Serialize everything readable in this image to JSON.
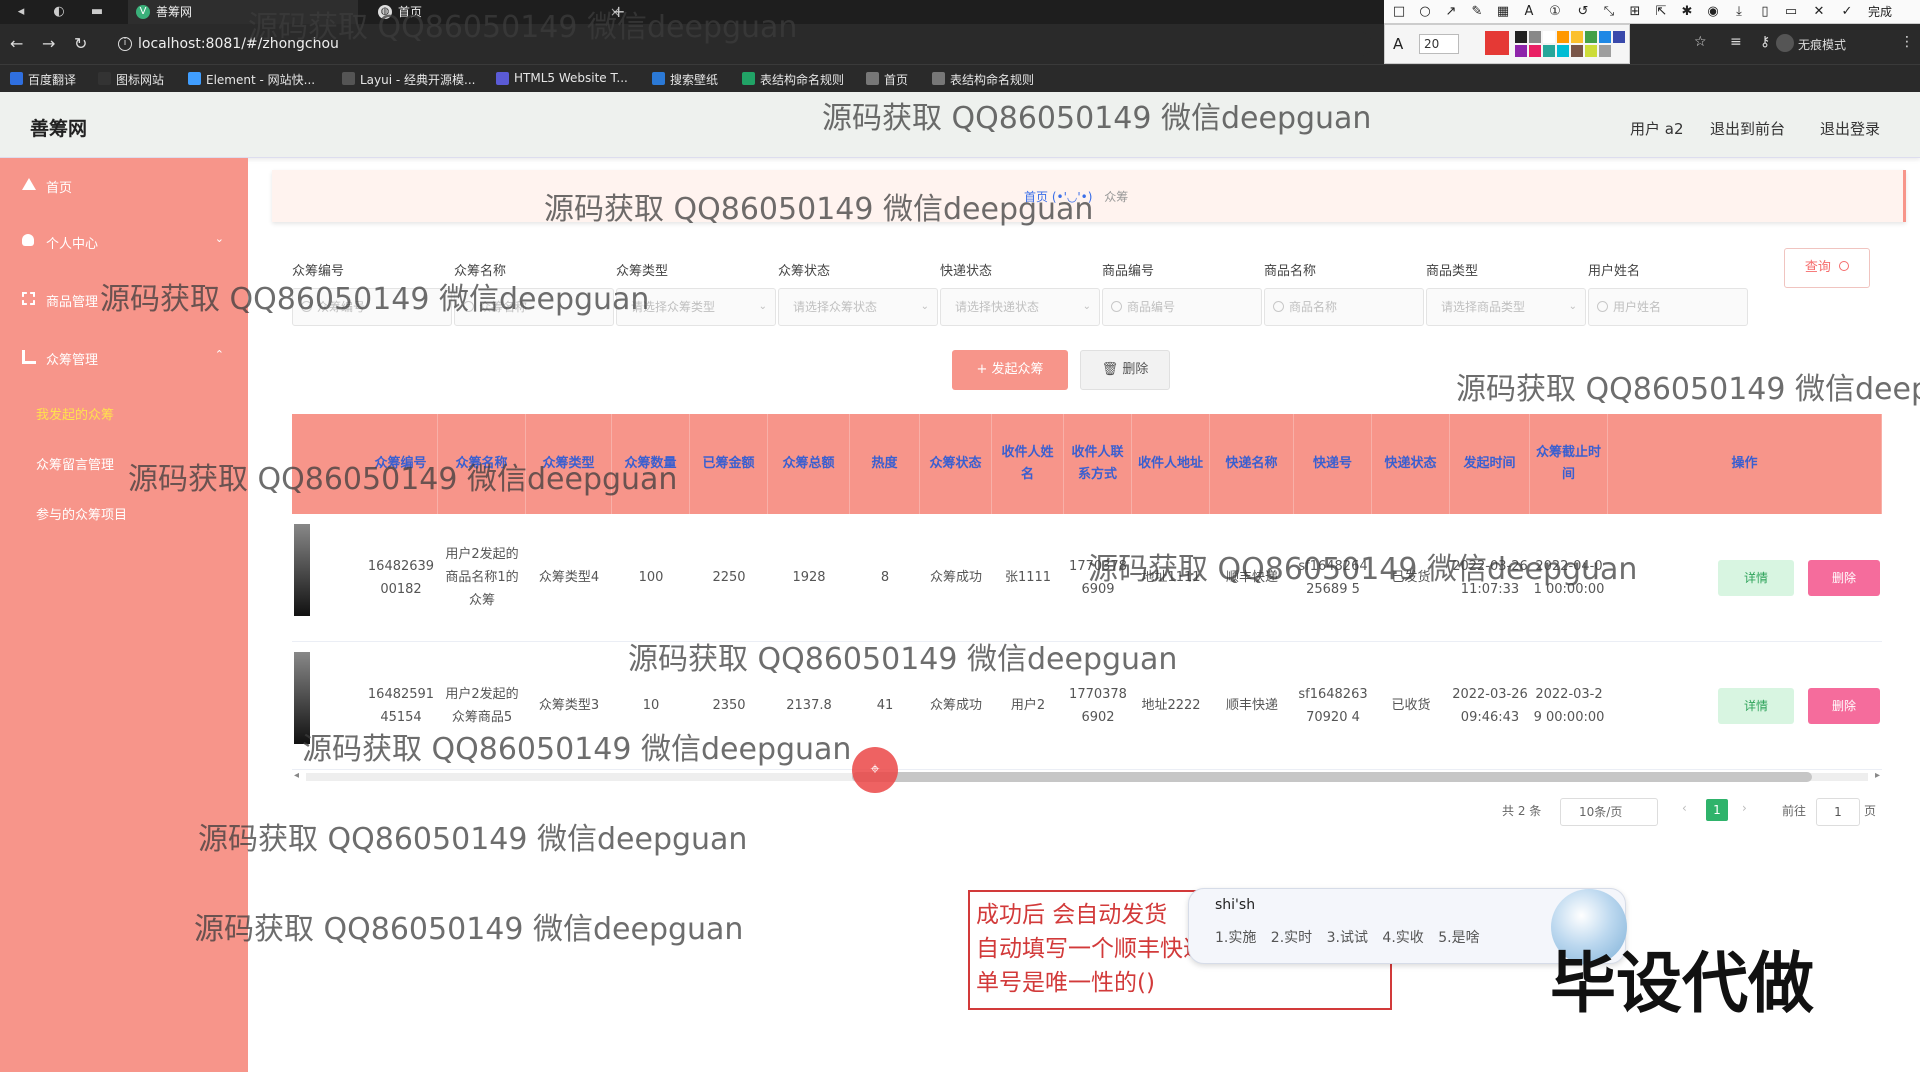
{
  "browser": {
    "tabs": [
      {
        "label": "善筹网"
      },
      {
        "label": "首页"
      }
    ],
    "new_tab": "+",
    "url": "localhost:8081/#/zhongchou",
    "incognito_label": "无痕模式",
    "annot_font_size": "20",
    "annot_done": "完成",
    "bookmarks": [
      {
        "label": "百度翻译",
        "color": "#2f6fe0"
      },
      {
        "label": "图标网站",
        "color": "#333333"
      },
      {
        "label": "Element - 网站快...",
        "color": "#409eff"
      },
      {
        "label": "Layui - 经典开源模...",
        "color": "#555555"
      },
      {
        "label": "HTML5 Website T...",
        "color": "#5b5bd6"
      },
      {
        "label": "搜索壁纸",
        "color": "#2b79d6"
      },
      {
        "label": "表结构命名规则",
        "color": "#21a366"
      },
      {
        "label": "首页",
        "color": "#777777"
      },
      {
        "label": "表结构命名规则",
        "color": "#777777"
      }
    ],
    "swatch_colors": [
      "#e53935",
      "#222222",
      "#888888",
      "#ffffff",
      "#ff9800",
      "#fbc02d",
      "#43a047",
      "#1e88e5",
      "#3949ab",
      "#8e24aa",
      "#e91e63",
      "#26a69a",
      "#00bcd4",
      "#795548",
      "#cddc39",
      "#9e9e9e"
    ]
  },
  "header": {
    "logo": "善筹网",
    "user": "用户 a2",
    "back_front": "退出到前台",
    "logout": "退出登录"
  },
  "sidebar": {
    "items": [
      {
        "label": "首页"
      },
      {
        "label": "个人中心"
      },
      {
        "label": "商品管理"
      },
      {
        "label": "众筹管理"
      }
    ],
    "subitems": [
      {
        "label": "我发起的众筹",
        "active": true
      },
      {
        "label": "众筹留言管理"
      },
      {
        "label": "参与的众筹项目"
      }
    ]
  },
  "breadcrumb": {
    "home": "首页",
    "face": "(•'◡'•)",
    "current": "众筹"
  },
  "filters": [
    {
      "label": "众筹编号",
      "placeholder": "众筹编号",
      "type": "input"
    },
    {
      "label": "众筹名称",
      "placeholder": "众筹名称",
      "type": "input"
    },
    {
      "label": "众筹类型",
      "placeholder": "请选择众筹类型",
      "type": "select"
    },
    {
      "label": "众筹状态",
      "placeholder": "请选择众筹状态",
      "type": "select"
    },
    {
      "label": "快递状态",
      "placeholder": "请选择快递状态",
      "type": "select"
    },
    {
      "label": "商品编号",
      "placeholder": "商品编号",
      "type": "input"
    },
    {
      "label": "商品名称",
      "placeholder": "商品名称",
      "type": "input"
    },
    {
      "label": "商品类型",
      "placeholder": "请选择商品类型",
      "type": "select"
    },
    {
      "label": "用户姓名",
      "placeholder": "用户姓名",
      "type": "input"
    }
  ],
  "actions": {
    "query": "查询",
    "add": "+ 发起众筹",
    "delete": "删除"
  },
  "table": {
    "columns": [
      "众筹编号",
      "众筹名称",
      "众筹类型",
      "众筹数量",
      "已筹金额",
      "众筹总额",
      "热度",
      "众筹状态",
      "收件人姓名",
      "收件人联系方式",
      "收件人地址",
      "快递名称",
      "快递号",
      "快递状态",
      "发起时间",
      "众筹截止时间",
      "操作"
    ],
    "rows": [
      [
        "1648263900182",
        "用户2发起的商品名称1的众筹",
        "众筹类型4",
        "100",
        "2250",
        "1928",
        "8",
        "众筹成功",
        "张1111",
        "17703786909",
        "地址1111",
        "顺丰快递",
        "sf164826425689 5",
        "已发货",
        "2022-03-26 11:07:33",
        "2022-04-01 00:00:00"
      ],
      [
        "1648259145154",
        "用户2发起的众筹商品5",
        "众筹类型3",
        "10",
        "2350",
        "2137.8",
        "41",
        "众筹成功",
        "用户2",
        "17703786902",
        "地址2222",
        "顺丰快递",
        "sf164826370920 4",
        "已收货",
        "2022-03-26 09:46:43",
        "2022-03-29 00:00:00"
      ]
    ],
    "detail_label": "详情",
    "delete_label": "删除"
  },
  "pagination": {
    "total": "共 2 条",
    "page_size": "10条/页",
    "current": "1",
    "goto": "前往",
    "goto_value": "1",
    "page_unit": "页"
  },
  "note": {
    "text": "成功后  会自动发货\n自动填写一个顺丰快递\n单号是唯一性的()"
  },
  "ime": {
    "composition": "shi'sh",
    "candidates": "1.实施  2.实时  3.试试  4.实收  5.是啥"
  },
  "promo": "毕设代做",
  "watermark": "源码获取 QQ86050149 微信deepguan"
}
